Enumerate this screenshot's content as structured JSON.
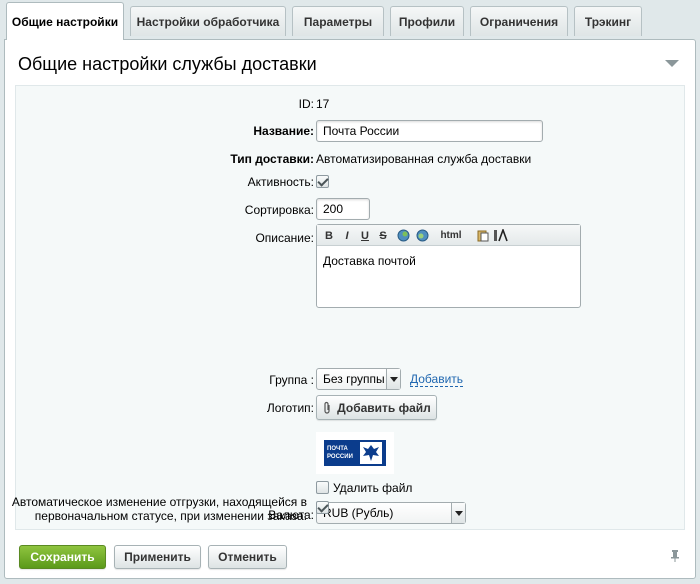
{
  "tabs": [
    {
      "label": "Общие настройки",
      "active": true
    },
    {
      "label": "Настройки обработчика"
    },
    {
      "label": "Параметры"
    },
    {
      "label": "Профили"
    },
    {
      "label": "Ограничения"
    },
    {
      "label": "Трэкинг"
    }
  ],
  "panel": {
    "title": "Общие настройки службы доставки"
  },
  "form": {
    "id": {
      "label": "ID:",
      "value": "17"
    },
    "name": {
      "label": "Название:",
      "value": "Почта России"
    },
    "type": {
      "label": "Тип доставки:",
      "value": "Автоматизированная служба доставки"
    },
    "active": {
      "label": "Активность:",
      "checked": true
    },
    "sort": {
      "label": "Сортировка:",
      "value": "200"
    },
    "description": {
      "label": "Описание:",
      "toolbar": [
        "B",
        "I",
        "U",
        "S",
        "html"
      ],
      "value": "Доставка почтой"
    },
    "group": {
      "label": "Группа :",
      "value": "Без группы",
      "add_link": "Добавить"
    },
    "logo": {
      "label": "Логотип:",
      "add_file_button": "Добавить файл",
      "logo_text_line1": "ПОЧТА",
      "logo_text_line2": "РОССИИ",
      "delete_label": "Удалить файл",
      "delete_checked": false
    },
    "currency": {
      "label": "Валюта:",
      "value": "RUB (Рубль)"
    },
    "auto_change": {
      "label_line1": "Автоматическое изменение отгрузки, находящейся в",
      "label_line2": "первоначальном статусе, при изменении заказа:",
      "checked": true
    }
  },
  "buttons": {
    "save": "Сохранить",
    "apply": "Применить",
    "cancel": "Отменить"
  },
  "colors": {
    "accent_green": "#6aa826",
    "link_blue": "#2067b0",
    "logo_blue": "#0b3c8c"
  }
}
